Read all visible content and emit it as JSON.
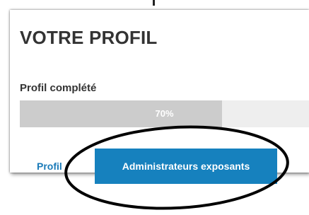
{
  "profile": {
    "title": "VOTRE PROFIL",
    "progress_label": "Profil complété",
    "progress_value": 70,
    "progress_text": "70%"
  },
  "tabs": [
    {
      "label": "Profil",
      "active": false
    },
    {
      "label": "Administrateurs exposants",
      "active": true
    }
  ],
  "colors": {
    "title_text": "#333333",
    "progress_fill": "#cccccc",
    "progress_track": "#eeeeee",
    "tab_active_bg": "#1681be",
    "tab_link": "#1a7ab8",
    "annotation_circle": "#000000"
  }
}
